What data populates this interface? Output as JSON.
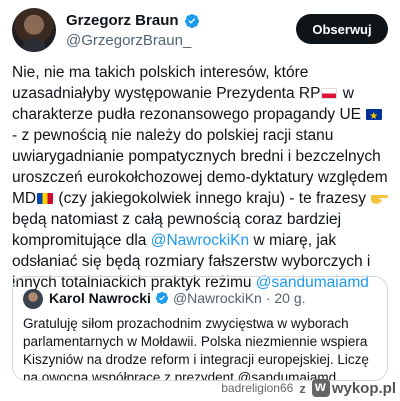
{
  "author": {
    "display_name": "Grzegorz Braun",
    "handle": "@GrzegorzBraun_",
    "follow_label": "Obserwuj"
  },
  "tweet": {
    "p1": "Nie, nie ma takich polskich interesów, które uzasadniałyby występowanie Prezydenta RP",
    "p2": " w charakterze pudła rezonansowego propagandy UE ",
    "p3": " - z pewnością nie należy do polskiej racji stanu uwiarygadnianie pompatycznych bredni i bezczelnych uroszczeń eurokołchozowej demo-dyktatury względem MD",
    "p4": " (czy jakiegokolwiek innego kraju) - te frazesy ",
    "p5": " będą natomiast z całą pewnością coraz bardziej kompromitujące dla ",
    "mention1": "@NawrockiKn",
    "p6": " w miarę, jak odsłaniać się będą rozmiary fałszerstw wyborczych i innych totalniackich praktyk reżimu ",
    "mention2": "@sandumaiamd"
  },
  "quote": {
    "display_name": "Karol Nawrocki",
    "handle": "@NawrockiKn",
    "time": "· 20 g.",
    "text": "Gratuluję siłom prozachodnim zwycięstwa w wyborach parlamentarnych w Mołdawii. Polska niezmiennie wspiera Kiszyniów na drodze reform i integracji europejskiej. Liczę na owocną współpracę z prezydent @sandumaiamd."
  },
  "footer": {
    "username": "badreligion66",
    "separator": "z",
    "site": "wykop.pl"
  },
  "colors": {
    "link": "#1d9bf0",
    "verified": "#1d9bf0",
    "follow_button_bg": "#0f1419"
  },
  "icons": [
    "verified-badge-icon",
    "flag-poland-icon",
    "flag-eu-icon",
    "flag-moldova-icon",
    "pointing-hand-icon",
    "wykop-logo-icon"
  ]
}
